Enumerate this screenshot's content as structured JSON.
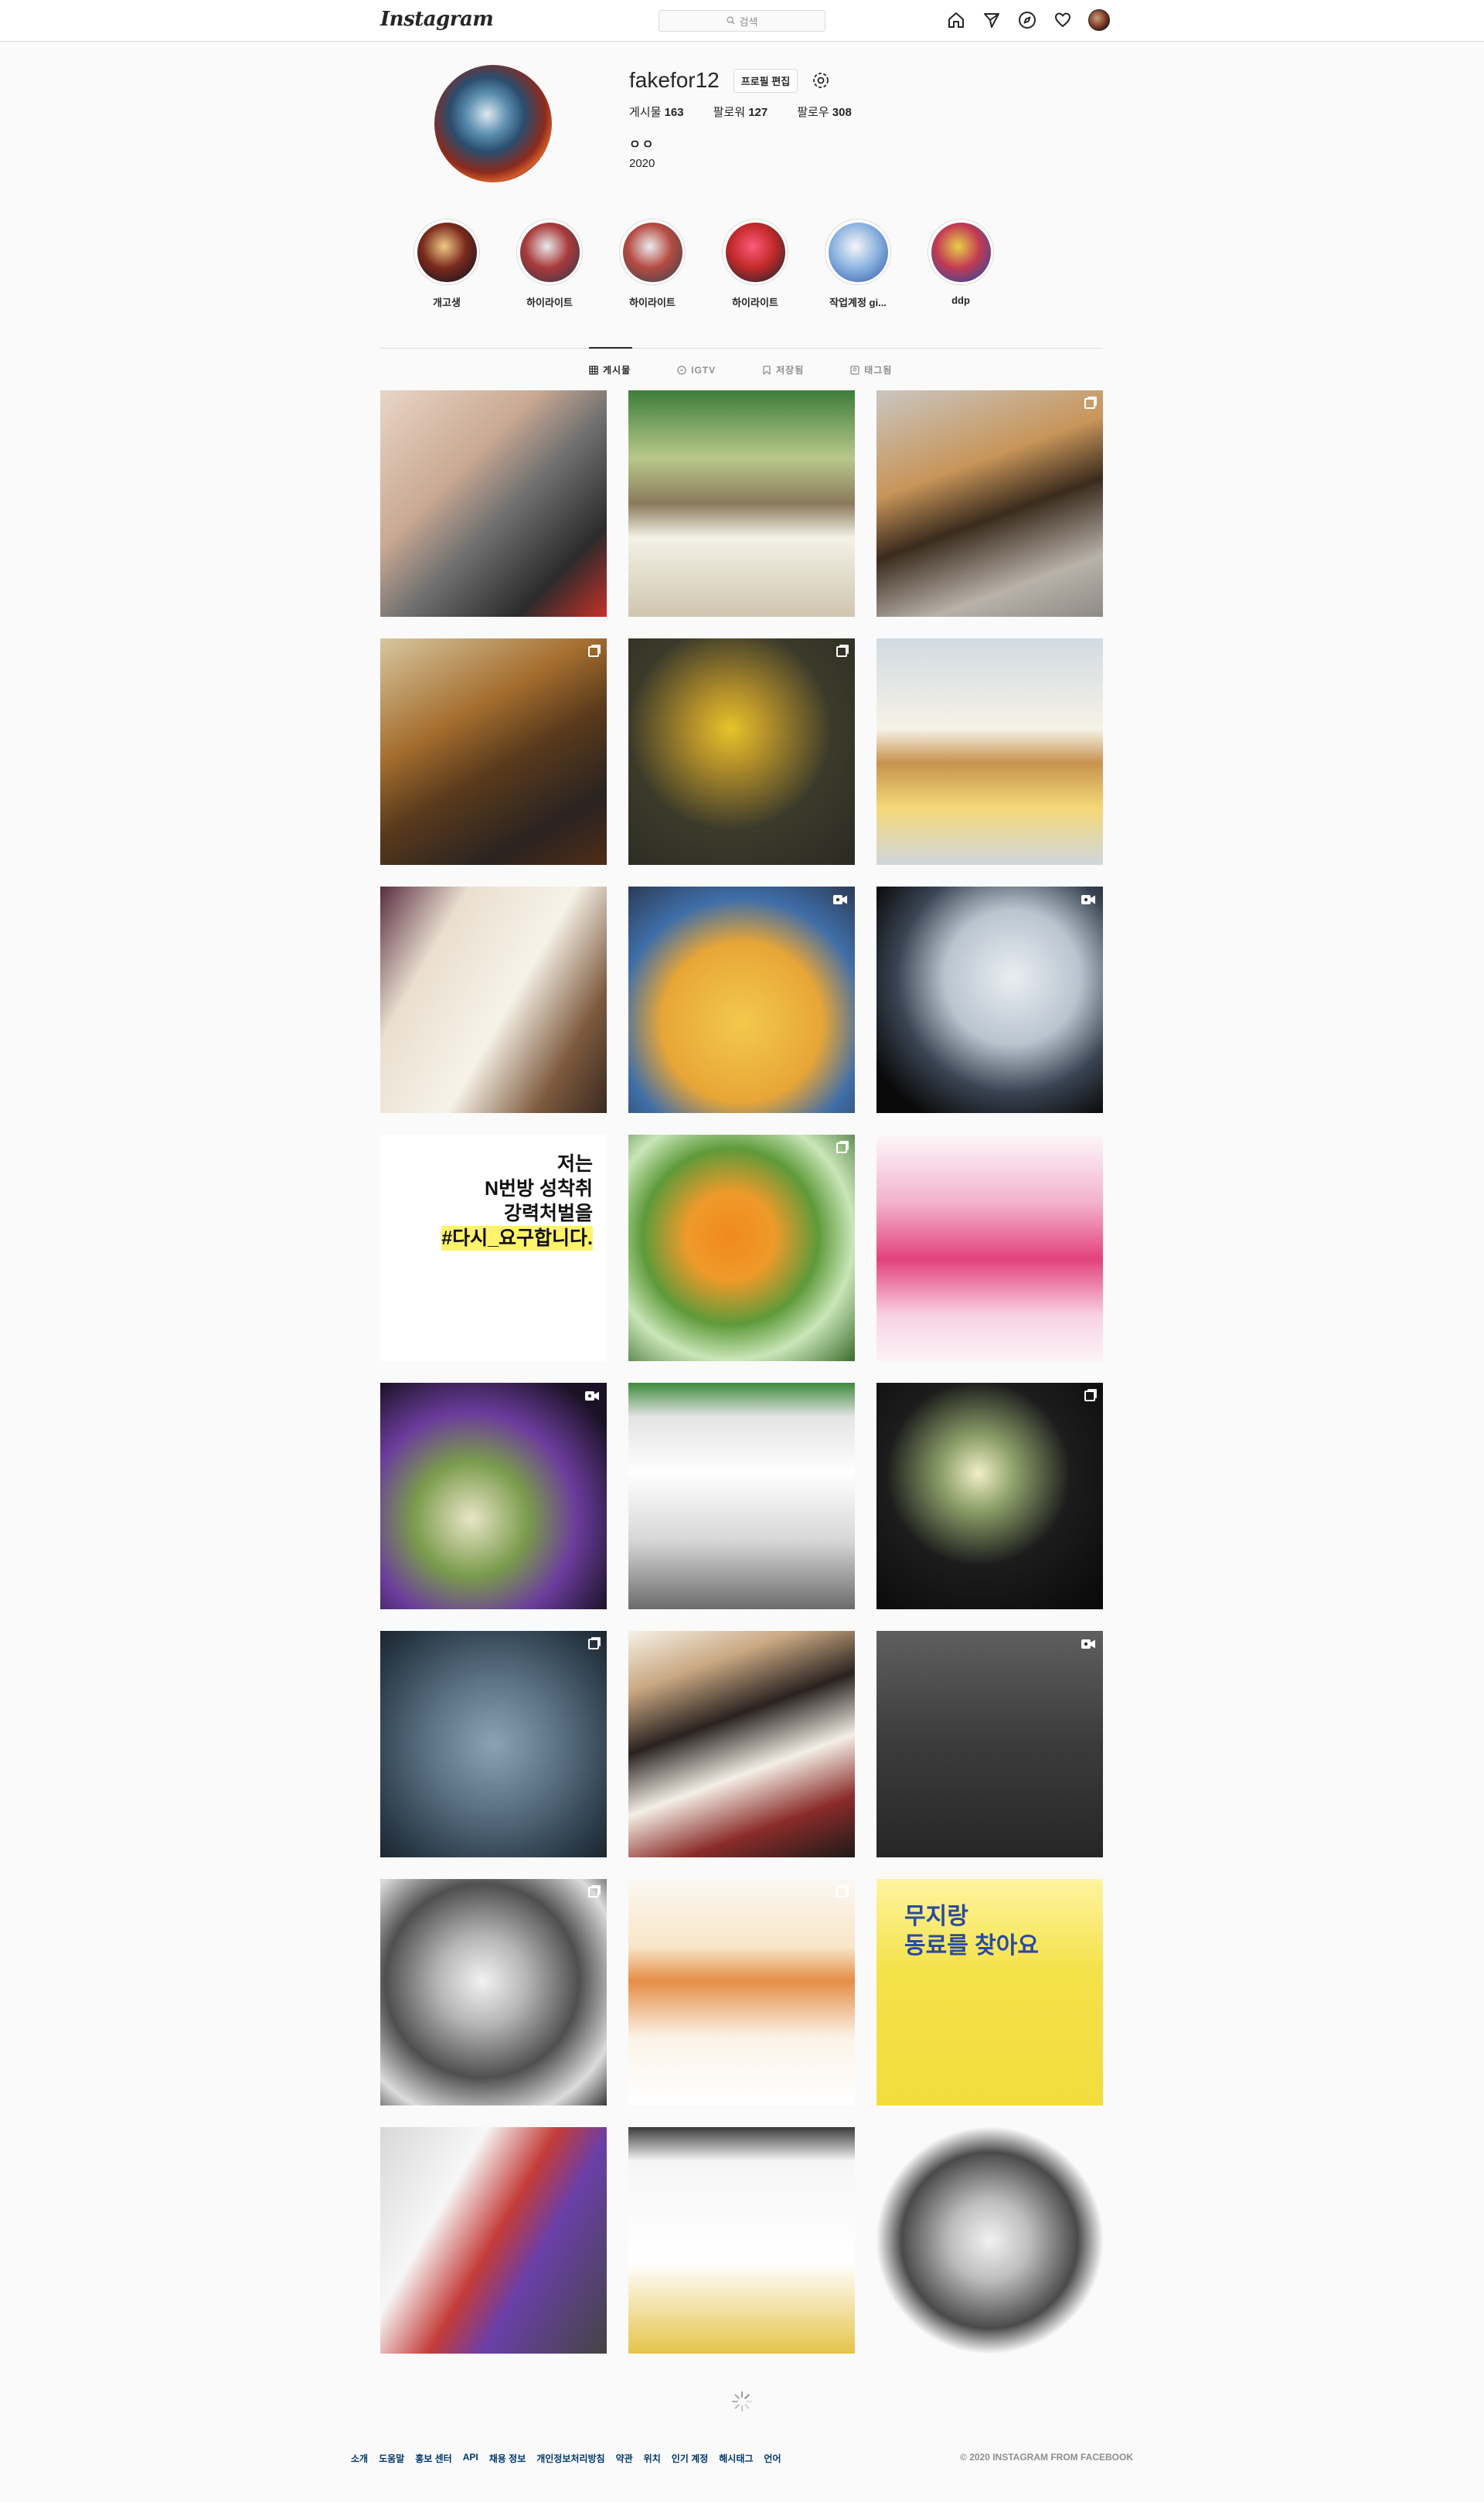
{
  "nav": {
    "logo": "Instagram",
    "search_placeholder": "검색"
  },
  "profile": {
    "username": "fakefor12",
    "edit_label": "프로필 편집",
    "stats": {
      "posts_label": "게시물",
      "posts": "163",
      "followers_label": "팔로워",
      "followers": "127",
      "following_label": "팔로우",
      "following": "308"
    },
    "bio_name": "ㅇㅇ",
    "bio": "2020"
  },
  "highlights": [
    {
      "label": "개고생",
      "colors": [
        "#f0c987",
        "#7b2a1c",
        "#151520"
      ]
    },
    {
      "label": "하이라이트",
      "colors": [
        "#e9e9ec",
        "#a93a3a",
        "#3b3b48"
      ]
    },
    {
      "label": "하이라이트",
      "colors": [
        "#ececee",
        "#b54b42",
        "#45454f"
      ]
    },
    {
      "label": "하이라이트",
      "colors": [
        "#ff5a7a",
        "#c22a2a",
        "#2a2630"
      ]
    },
    {
      "label": "작업계정 gi...",
      "colors": [
        "#f6f6f9",
        "#8fb6e0",
        "#3d67b3"
      ]
    },
    {
      "label": "ddp",
      "colors": [
        "#e8cf4b",
        "#c33a52",
        "#3048a0"
      ]
    }
  ],
  "tabs": [
    {
      "label": "게시물",
      "icon": "grid-icon",
      "active": true
    },
    {
      "label": "IGTV",
      "icon": "igtv-icon",
      "active": false
    },
    {
      "label": "저장됨",
      "icon": "bookmark-icon",
      "active": false
    },
    {
      "label": "태그됨",
      "icon": "tag-icon",
      "active": false
    }
  ],
  "posts": [
    {
      "badge": "",
      "bg": "linear-gradient(135deg,#e9d5c6 0%,#c9a993 35%,#6f6f6f 55%,#2b2b2b 80%,#c6302a 100%)"
    },
    {
      "badge": "",
      "bg": "linear-gradient(180deg,#3d7d3a 0%,#b9c88a 30%,#8a7a5c 50%,#f4f1e6 65%,#cfc6b0 100%)"
    },
    {
      "badge": "multi",
      "bg": "linear-gradient(160deg,#c9c6c1 0%,#c8955a 35%,#3a2b1d 55%,#b9b2a9 80%,#8e8a86 100%)"
    },
    {
      "badge": "multi",
      "bg": "linear-gradient(150deg,#d8c7a0 0%,#a46d2e 35%,#5a3a1c 55%,#2a2320 80%,#4f2d16 100%)"
    },
    {
      "badge": "multi",
      "bg": "radial-gradient(circle at 45% 40%,#e6c42a 0%,#b4902a 20%,#3b3a2a 55%,#2a2a23 100%)"
    },
    {
      "badge": "",
      "bg": "linear-gradient(180deg,#d2dbe3 0%,#f6f2e6 40%,#c7924e 55%,#f5d978 75%,#cfd6dd 100%)"
    },
    {
      "badge": "",
      "bg": "linear-gradient(120deg,#5a2d41 0%,#e9dfcf 25%,#f7f2e8 55%,#7d5a3e 80%,#3a2a20 100%)"
    },
    {
      "badge": "video",
      "bg": "radial-gradient(circle at 50% 60%,#f2c94c 0%,#e8a637 45%,#3f6ea8 70%,#2c3b56 100%)"
    },
    {
      "badge": "video",
      "bg": "radial-gradient(circle at 60% 40%,#e9eef2 0%,#b9c4cf 35%,#394453 60%,#0a0a0a 85%)"
    },
    {
      "badge": "multi",
      "bg": "linear-gradient(180deg,#ffffff 0%,#ffffff 100%)",
      "text": [
        "저는",
        "N번방 성착취",
        "강력처벌을",
        "#다시_요구합니다."
      ]
    },
    {
      "badge": "multi",
      "bg": "radial-gradient(circle at 45% 45%,#f08a1c 0%,#ee9a2a 25%,#5e9a3a 50%,#c9e6b8 70%,#3d6b2d 100%)"
    },
    {
      "badge": "",
      "bg": "linear-gradient(180deg,#fdf7fa 0%,#f3b2cc 30%,#e3427c 55%,#f8d3e2 80%,#fcf3f7 100%)"
    },
    {
      "badge": "video",
      "bg": "radial-gradient(circle at 40% 60%,#e9e6c7 0%,#7a9b4c 30%,#6b3c9c 55%,#1b1226 85%)"
    },
    {
      "badge": "",
      "bg": "linear-gradient(180deg,#3c8a3a 0%,#e4e4e4 15%,#ffffff 40%,#d6d6d6 70%,#6b6b6b 100%)"
    },
    {
      "badge": "multi",
      "bg": "radial-gradient(circle at 45% 40%,#f2efc8 0%,#8da06a 20%,#1c1c1c 50%,#080808 100%)"
    },
    {
      "badge": "multi",
      "bg": "radial-gradient(circle at 50% 50%,#8aa3b4 0%,#5c7386 40%,#2c3c4a 80%,#1b2630 100%)"
    },
    {
      "badge": "",
      "bg": "linear-gradient(160deg,#f6f1e8 0%,#c9a882 20%,#2a2220 40%,#f4efe6 60%,#8a2c2a 80%,#1e1a18 100%)"
    },
    {
      "badge": "video",
      "bg": "linear-gradient(180deg,#5f5f5f 0%,#3b3b3b 50%,#262626 100%)"
    },
    {
      "badge": "multi",
      "bg": "radial-gradient(circle at 45% 45%,#f2f2f2 0%,#b6b6b6 25%,#4f4f4f 55%,#dcdcdc 80%,#3a3a3a 100%)"
    },
    {
      "badge": "multi",
      "bg": "linear-gradient(180deg,#fbf7f2 0%,#f8e6c8 30%,#e58d45 45%,#fbf3e8 70%,#ffffff 100%)"
    },
    {
      "badge": "",
      "bg": "linear-gradient(180deg,#fff4a0 0%,#f4e24a 40%,#f2dd3c 100%)",
      "text": [
        "무지랑",
        "동료를 찾아요"
      ]
    },
    {
      "badge": "",
      "bg": "linear-gradient(120deg,#d8d8d8 0%,#f7f7f7 30%,#c33c39 50%,#6a3fa8 65%,#444 100%)"
    },
    {
      "badge": "",
      "bg": "linear-gradient(180deg,#3a3a3a 0%,#f6f6f6 15%,#ffffff 60%,#e5c44a 100%)"
    },
    {
      "badge": "",
      "bg": "radial-gradient(circle at 50% 50%,#f2f2f2 0%,#bdbdbd 25%,#4a4a4a 55%,#fafafa 71%,#fafafa 100%)"
    }
  ],
  "footer": {
    "links": [
      "소개",
      "도움말",
      "홍보 센터",
      "API",
      "채용 정보",
      "개인정보처리방침",
      "약관",
      "위치",
      "인기 계정",
      "해시태그",
      "언어"
    ],
    "copyright": "© 2020 Instagram from Facebook"
  }
}
